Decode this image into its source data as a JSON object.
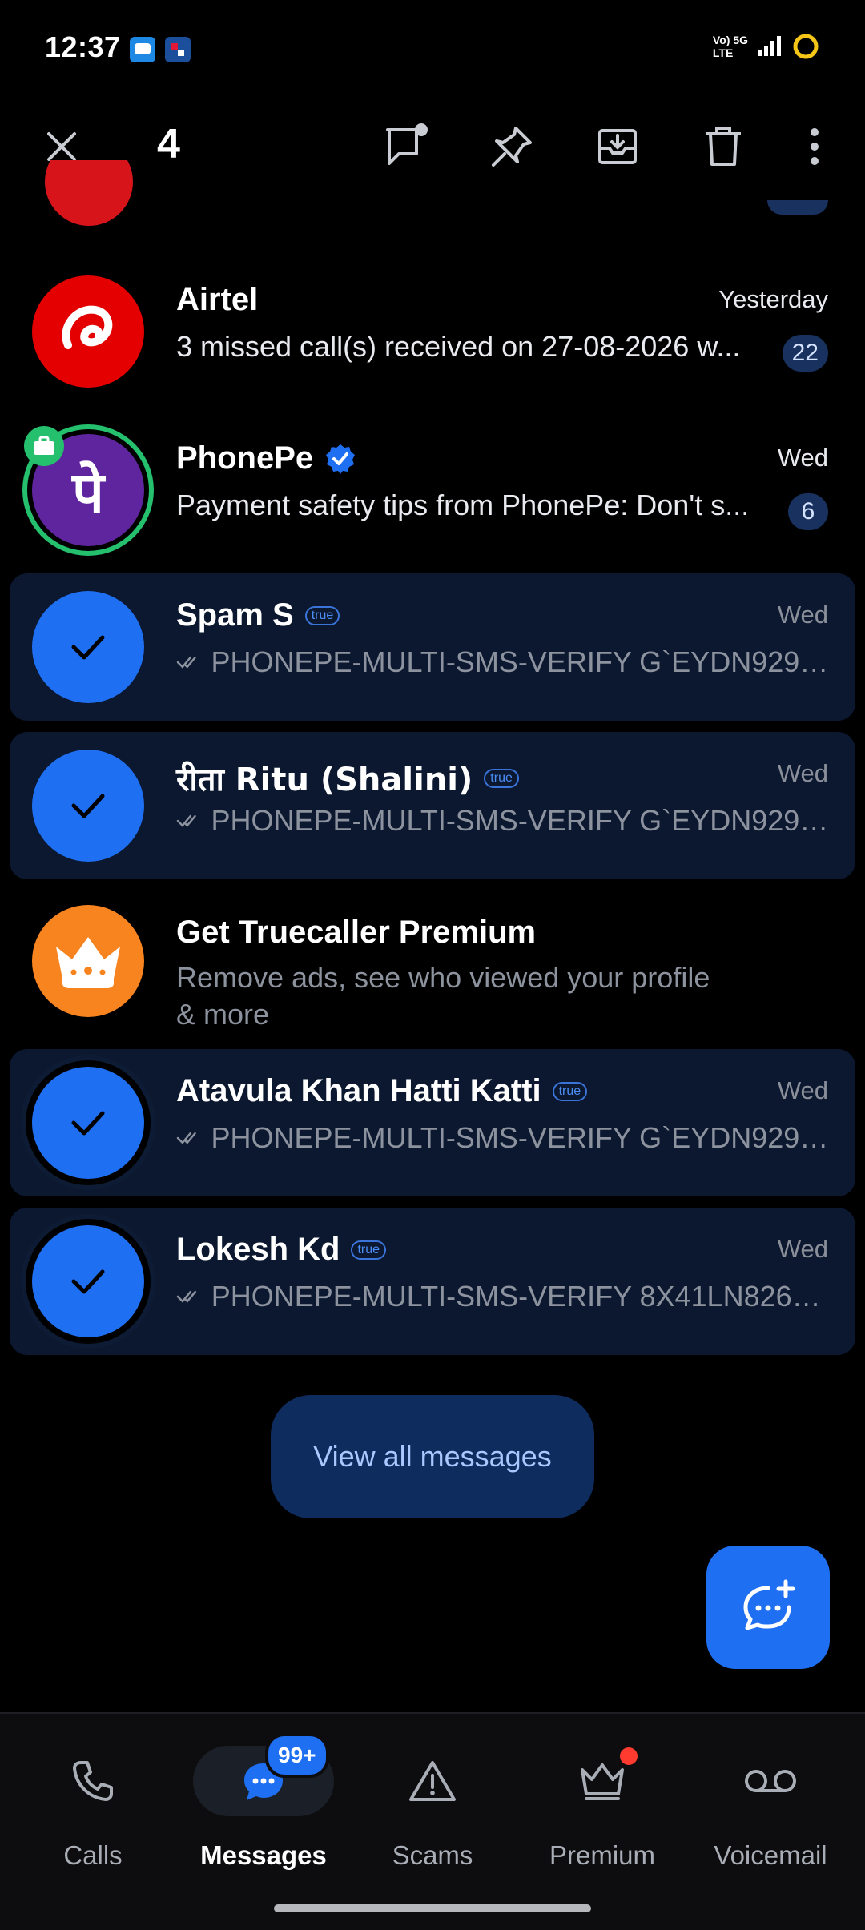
{
  "status_bar": {
    "time": "12:37",
    "network_line1": "Vo) 5G",
    "network_line2": "LTE",
    "icons": [
      "chat-app-icon",
      "dominos-icon",
      "signal-icon",
      "battery-ring-icon"
    ]
  },
  "toolbar": {
    "selected_count": "4",
    "icons": [
      "close-icon",
      "mark-read-icon",
      "pin-icon",
      "archive-icon",
      "delete-icon",
      "more-icon"
    ]
  },
  "rows": [
    {
      "name": "Airtel",
      "date": "Yesterday",
      "snippet": "3 missed call(s) received on 27-08-2026 w...",
      "badge": "22",
      "selected": false
    },
    {
      "name": "PhonePe",
      "date": "Wed",
      "snippet": "Payment safety tips from PhonePe: Don't s...",
      "badge": "6",
      "avatar_text": "पे",
      "selected": false
    },
    {
      "name": "Spam S",
      "tag": "true",
      "date": "Wed",
      "snippet": "PHONEPE-MULTI-SMS-VERIFY G`EYDN929D...",
      "selected": true
    },
    {
      "name": "रीता Ritu (Shalini)",
      "tag": "true",
      "date": "Wed",
      "snippet": "PHONEPE-MULTI-SMS-VERIFY G`EYDN929D...",
      "selected": true
    },
    {
      "name": "Get Truecaller Premium",
      "snippet_line1": "Remove ads, see who viewed your profile",
      "snippet_line2": "& more",
      "selected": false
    },
    {
      "name": "Atavula Khan Hatti Katti",
      "tag": "true",
      "date": "Wed",
      "snippet": "PHONEPE-MULTI-SMS-VERIFY G`EYDN929D...",
      "selected": true
    },
    {
      "name": "Lokesh Kd",
      "tag": "true",
      "date": "Wed",
      "snippet": "PHONEPE-MULTI-SMS-VERIFY 8X41LN826G...",
      "selected": true
    }
  ],
  "view_all_label": "View all messages",
  "bottom_nav": {
    "items": [
      {
        "label": "Calls",
        "icon": "phone-icon"
      },
      {
        "label": "Messages",
        "icon": "messages-icon",
        "badge": "99+",
        "active": true
      },
      {
        "label": "Scams",
        "icon": "warning-icon"
      },
      {
        "label": "Premium",
        "icon": "crown-icon"
      },
      {
        "label": "Voicemail",
        "icon": "voicemail-icon"
      }
    ]
  },
  "colors": {
    "accent": "#1f6ff2",
    "selected_row": "#0b1830",
    "airtel_red": "#e40000",
    "phonepe_purple": "#5f259f",
    "premium_orange": "#f7841f"
  }
}
